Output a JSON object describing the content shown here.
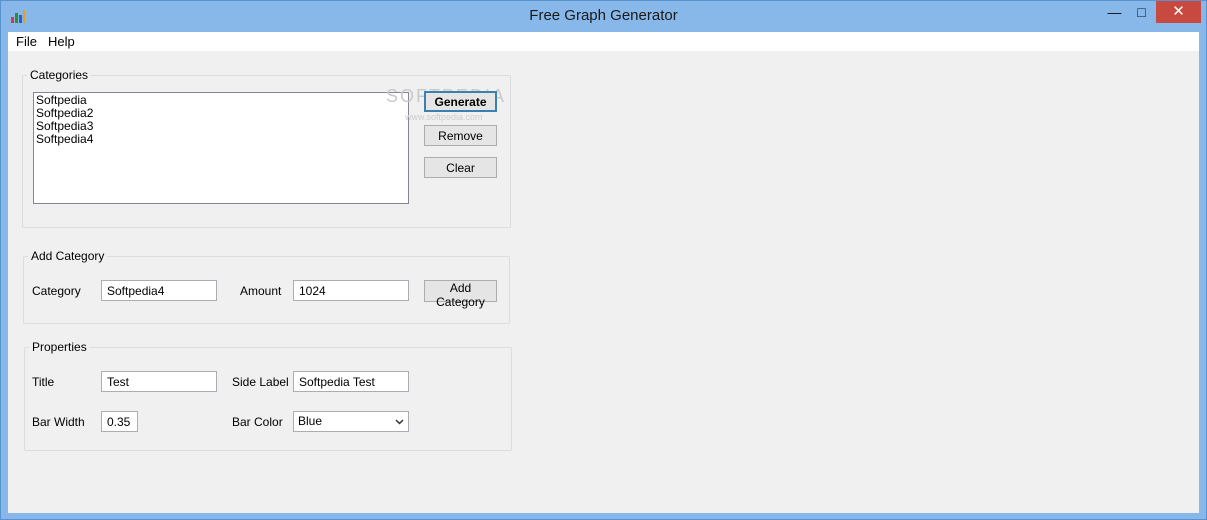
{
  "window": {
    "title": "Free Graph Generator",
    "minimize": "—",
    "maximize": "□",
    "close": "✕"
  },
  "menu": {
    "file": "File",
    "help": "Help"
  },
  "categories": {
    "legend": "Categories",
    "items": [
      "Softpedia",
      "Softpedia2",
      "Softpedia3",
      "Softpedia4"
    ],
    "generate_label": "Generate",
    "remove_label": "Remove",
    "clear_label": "Clear"
  },
  "add_category": {
    "legend": "Add Category",
    "category_label": "Category",
    "category_value": "Softpedia4",
    "amount_label": "Amount",
    "amount_value": "1024",
    "add_button_label": "Add Category"
  },
  "properties": {
    "legend": "Properties",
    "title_label": "Title",
    "title_value": "Test",
    "side_label_label": "Side Label",
    "side_label_value": "Softpedia Test",
    "bar_width_label": "Bar Width",
    "bar_width_value": "0.35",
    "bar_color_label": "Bar Color",
    "bar_color_value": "Blue"
  },
  "watermark": {
    "text": "SOFTPEDIA",
    "sub": "www.softpedia.com"
  },
  "colors": {
    "titlebar": "#88b8ea",
    "close": "#c7493f",
    "client": "#f0f0f0"
  },
  "icons": {
    "app": "bar-chart-icon",
    "dropdown": "chevron-down-icon"
  }
}
